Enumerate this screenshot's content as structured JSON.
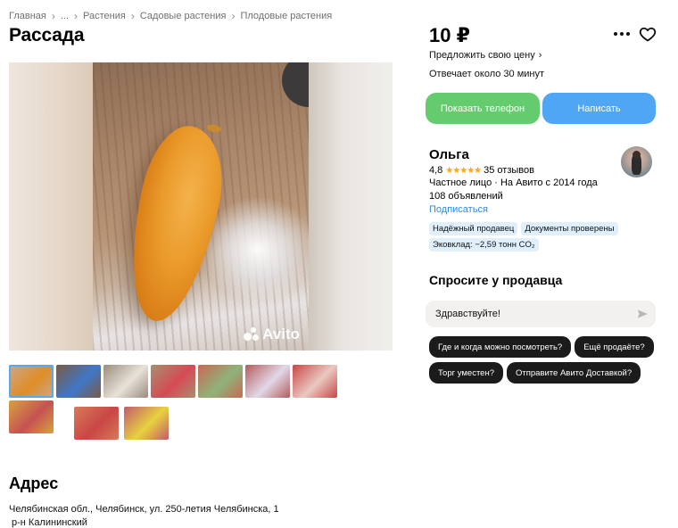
{
  "breadcrumbs": [
    "Главная",
    "...",
    "Растения",
    "Садовые растения",
    "Плодовые растения"
  ],
  "listing": {
    "title": "Рассада",
    "price": "10 ₽",
    "offer_price": "Предложить свою цену",
    "reply_time": "Отвечает около 30 минут",
    "watermark": "Avito"
  },
  "actions": {
    "show_phone": "Показать телефон",
    "write": "Написать"
  },
  "seller": {
    "name": "Ольга",
    "rating": "4,8",
    "stars": "★★★★★",
    "reviews": "35 отзывов",
    "type": "Частное лицо · На Авито с 2014 года",
    "ads": "108 объявлений",
    "subscribe": "Подписаться",
    "badges": [
      "Надёжный продавец",
      "Документы проверены",
      "Эковклад: −2,59 тонн CO₂"
    ]
  },
  "ask": {
    "heading": "Спросите у продавца",
    "input_value": "Здравствуйте!",
    "chips": [
      "Где и когда можно посмотреть?",
      "Ещё продаёте?",
      "Торг уместен?",
      "Отправите Авито Доставкой?"
    ]
  },
  "address": {
    "heading": "Адрес",
    "line": "Челябинская обл., Челябинск, ул. 250-летия Челябинска, 1",
    "district": "р-н Калининский"
  },
  "thumbnails": [
    {
      "colors": [
        "#c9a98d",
        "#e08d25"
      ]
    },
    {
      "colors": [
        "#7b5a45",
        "#3f77c7"
      ]
    },
    {
      "colors": [
        "#9a8c7c",
        "#e8e2d8"
      ]
    },
    {
      "colors": [
        "#a6906f",
        "#d64a55"
      ]
    },
    {
      "colors": [
        "#c86a54",
        "#8fb37a"
      ]
    },
    {
      "colors": [
        "#b35c5c",
        "#e2d8e8"
      ]
    },
    {
      "colors": [
        "#c94646",
        "#e8c9c1"
      ]
    },
    {
      "colors": [
        "#d7a23e",
        "#c55252"
      ]
    },
    {
      "colors": [
        "#d77a5a",
        "#c94646"
      ]
    },
    {
      "colors": [
        "#c45a6e",
        "#e7d23e"
      ]
    }
  ]
}
